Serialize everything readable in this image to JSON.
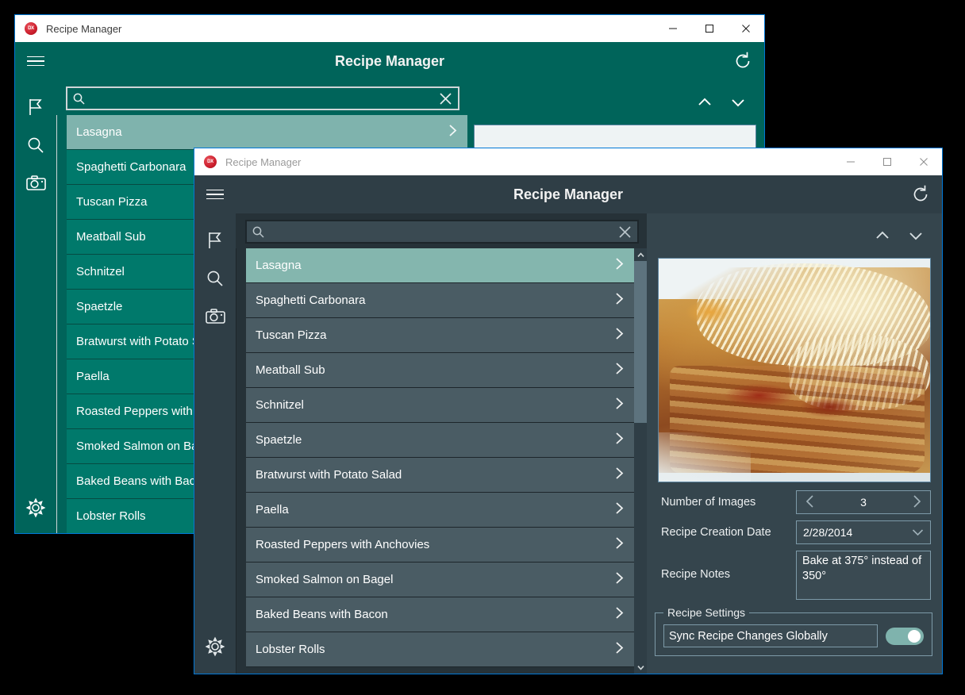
{
  "back_window": {
    "titlebar": {
      "app_icon": "dx-logo-icon",
      "title": "Recipe Manager",
      "minimize": "–",
      "maximize": "□",
      "close": "✕"
    },
    "header": {
      "menu_icon": "hamburger-menu-icon",
      "title": "Recipe Manager",
      "refresh_icon": "refresh-icon"
    },
    "rail": [
      {
        "name": "flag-icon"
      },
      {
        "name": "search-icon"
      },
      {
        "name": "camera-icon"
      },
      {
        "name": "gear-icon"
      }
    ],
    "search": {
      "placeholder": "",
      "value": "",
      "search_icon": "search-icon",
      "clear_icon": "close-icon"
    },
    "detail": {
      "prev_icon": "chevron-up-icon",
      "next_icon": "chevron-down-icon"
    },
    "recipes": [
      {
        "name": "Lasagna",
        "selected": true
      },
      {
        "name": "Spaghetti Carbonara",
        "selected": false
      },
      {
        "name": "Tuscan Pizza",
        "selected": false
      },
      {
        "name": "Meatball Sub",
        "selected": false
      },
      {
        "name": "Schnitzel",
        "selected": false
      },
      {
        "name": "Spaetzle",
        "selected": false
      },
      {
        "name": "Bratwurst with Potato Salad",
        "selected": false
      },
      {
        "name": "Paella",
        "selected": false
      },
      {
        "name": "Roasted Peppers with Anchovies",
        "selected": false
      },
      {
        "name": "Smoked Salmon on Bagel",
        "selected": false
      },
      {
        "name": "Baked Beans with Bacon",
        "selected": false
      },
      {
        "name": "Lobster Rolls",
        "selected": false
      }
    ]
  },
  "front_window": {
    "titlebar": {
      "app_icon": "dx-logo-icon",
      "title": "Recipe Manager",
      "minimize": "–",
      "maximize": "□",
      "close": "✕"
    },
    "header": {
      "menu_icon": "hamburger-menu-icon",
      "title": "Recipe Manager",
      "refresh_icon": "refresh-icon"
    },
    "rail": [
      {
        "name": "flag-icon"
      },
      {
        "name": "search-icon"
      },
      {
        "name": "camera-icon"
      },
      {
        "name": "gear-icon"
      }
    ],
    "search": {
      "placeholder": "",
      "value": "",
      "search_icon": "search-icon",
      "clear_icon": "close-icon"
    },
    "recipes": [
      {
        "name": "Lasagna",
        "selected": true
      },
      {
        "name": "Spaghetti Carbonara",
        "selected": false
      },
      {
        "name": "Tuscan Pizza",
        "selected": false
      },
      {
        "name": "Meatball Sub",
        "selected": false
      },
      {
        "name": "Schnitzel",
        "selected": false
      },
      {
        "name": "Spaetzle",
        "selected": false
      },
      {
        "name": "Bratwurst with Potato Salad",
        "selected": false
      },
      {
        "name": "Paella",
        "selected": false
      },
      {
        "name": "Roasted Peppers with Anchovies",
        "selected": false
      },
      {
        "name": "Smoked Salmon on Bagel",
        "selected": false
      },
      {
        "name": "Baked Beans with Bacon",
        "selected": false
      },
      {
        "name": "Lobster Rolls",
        "selected": false
      }
    ],
    "detail": {
      "prev_icon": "chevron-up-icon",
      "next_icon": "chevron-down-icon",
      "image_alt": "lasagna-photo",
      "fields": {
        "number_of_images_label": "Number of Images",
        "number_of_images_value": "3",
        "spin_down_icon": "chevron-left-icon",
        "spin_up_icon": "chevron-right-icon",
        "creation_date_label": "Recipe Creation Date",
        "creation_date_value": "2/28/2014",
        "date_dropdown_icon": "chevron-down-icon",
        "notes_label": "Recipe Notes",
        "notes_value": "Bake at 375° instead of 350°"
      },
      "settings_group": {
        "legend": "Recipe Settings",
        "sync_label": "Sync Recipe Changes Globally",
        "sync_on": true
      }
    }
  },
  "colors": {
    "back_accent": "#00796b",
    "back_selected": "#7fb3ad",
    "front_bg": "#2f3e46",
    "front_list_item": "#4a5c64",
    "front_selected": "#84b6ae",
    "toggle_on": "#7fb3ad",
    "titlebar_border": "#0078d7"
  }
}
